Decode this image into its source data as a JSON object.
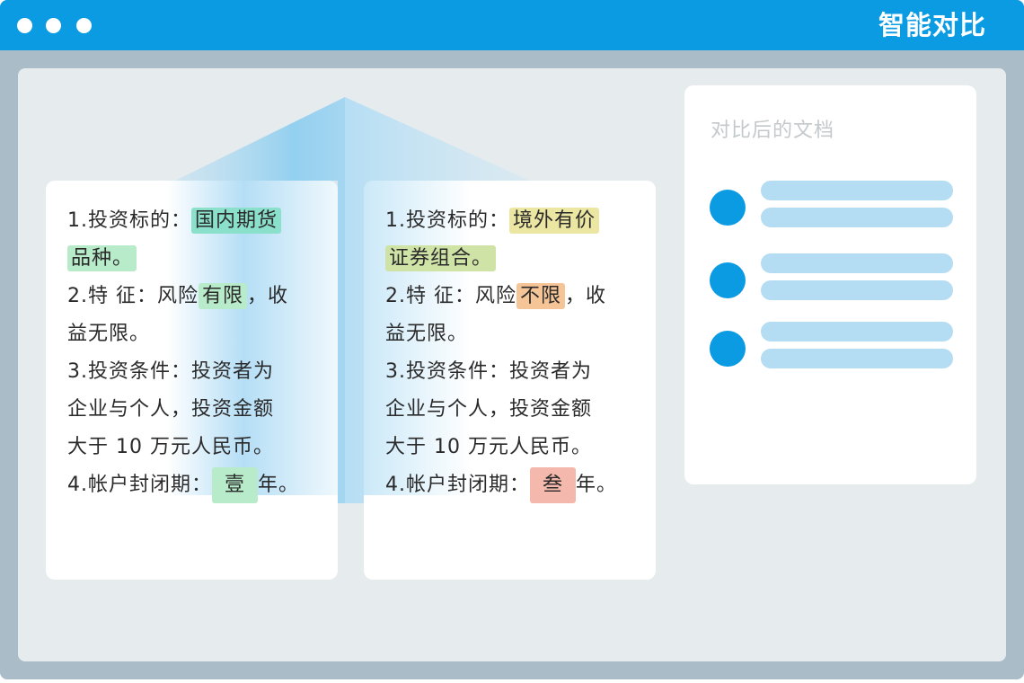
{
  "window": {
    "title": "智能对比",
    "controls": [
      "dot-icon",
      "dot-icon",
      "dot-icon"
    ]
  },
  "left_doc": {
    "lines": [
      [
        {
          "t": "1.投资标的："
        },
        {
          "t": "国内期货",
          "hl": "teal"
        }
      ],
      [
        {
          "t": "品种。",
          "hl": "green"
        }
      ],
      [
        {
          "t": "2.特  征：风险"
        },
        {
          "t": "有限",
          "hl": "green"
        },
        {
          "t": "，收"
        }
      ],
      [
        {
          "t": "益无限。"
        }
      ],
      [
        {
          "t": "3.投资条件：投资者为"
        }
      ],
      [
        {
          "t": "企业与个人，投资金额"
        }
      ],
      [
        {
          "t": "大于  10  万元人民币。"
        }
      ],
      [
        {
          "t": "4.帐户封闭期："
        },
        {
          "t": "壹",
          "hl": "green",
          "box": true
        },
        {
          "t": "年。"
        }
      ]
    ]
  },
  "right_doc": {
    "lines": [
      [
        {
          "t": "1.投资标的："
        },
        {
          "t": "境外有价",
          "hl": "yellow"
        }
      ],
      [
        {
          "t": "证券组合。",
          "hl": "olive"
        }
      ],
      [
        {
          "t": "2.特  征：风险"
        },
        {
          "t": "不限",
          "hl": "orange"
        },
        {
          "t": "，收"
        }
      ],
      [
        {
          "t": "益无限。"
        }
      ],
      [
        {
          "t": "3.投资条件：投资者为"
        }
      ],
      [
        {
          "t": "企业与个人，投资金额"
        }
      ],
      [
        {
          "t": "大于  10  万元人民币。"
        }
      ],
      [
        {
          "t": "4.帐户封闭期："
        },
        {
          "t": "叁",
          "hl": "salmon",
          "box": true
        },
        {
          "t": "年。"
        }
      ]
    ]
  },
  "result_doc": {
    "title": "对比后的文档",
    "items": 3
  },
  "colors": {
    "accent": "#0a9be3",
    "frame": "#a9bcc7",
    "canvas": "#e6ebee",
    "placeholder_bar": "#b4dcf2"
  }
}
